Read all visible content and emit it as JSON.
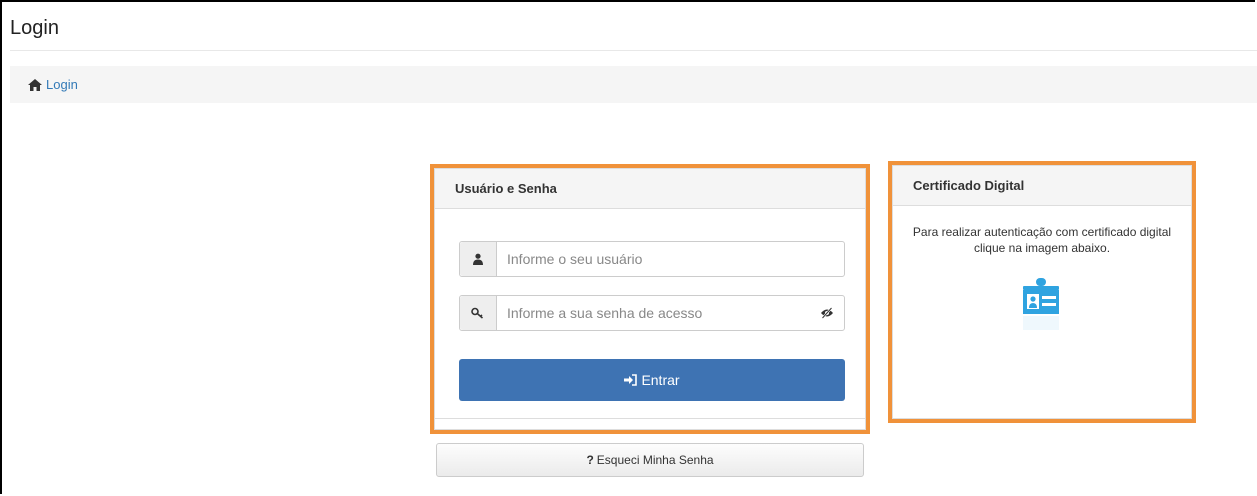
{
  "page": {
    "title": "Login"
  },
  "breadcrumb": {
    "home_label": "Login"
  },
  "login_panel": {
    "heading": "Usuário e Senha",
    "username_placeholder": "Informe o seu usuário",
    "password_placeholder": "Informe a sua senha de acesso",
    "submit_label": "Entrar"
  },
  "cert_panel": {
    "heading": "Certificado Digital",
    "line1": "Para realizar autenticação com certificado digital",
    "line2": "clique na imagem abaixo."
  },
  "forgot": {
    "label": "Esqueci Minha Senha"
  },
  "colors": {
    "highlight": "#f0923a",
    "primary": "#3e73b3",
    "cert_icon": "#2fa3e0"
  },
  "icons": [
    "home-icon",
    "user-icon",
    "key-icon",
    "eye-slash-icon",
    "sign-in-icon",
    "question-icon",
    "id-card-icon"
  ]
}
